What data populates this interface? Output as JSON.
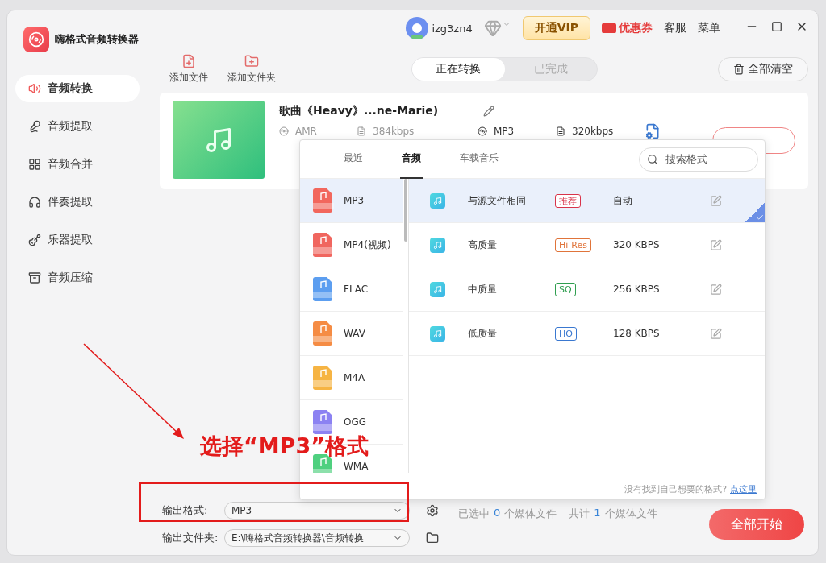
{
  "app": {
    "title": "嗨格式音频转换器"
  },
  "sidebar": {
    "items": [
      {
        "label": "音频转换",
        "selected": true
      },
      {
        "label": "音频提取",
        "selected": false
      },
      {
        "label": "音频合并",
        "selected": false
      },
      {
        "label": "伴奏提取",
        "selected": false
      },
      {
        "label": "乐器提取",
        "selected": false
      },
      {
        "label": "音频压缩",
        "selected": false
      }
    ]
  },
  "header": {
    "username": "izg3zn4",
    "vip_button": "开通VIP",
    "coupon": "优惠券",
    "links": [
      "客服",
      "菜单"
    ]
  },
  "toolbar": {
    "actions": [
      "添加文件",
      "添加文件夹"
    ],
    "tabs": [
      {
        "label": "正在转换",
        "selected": true
      },
      {
        "label": "已完成",
        "selected": false
      }
    ],
    "clear_button": "全部清空"
  },
  "file": {
    "name": "歌曲《Heavy》...ne-Marie)",
    "source_format": "AMR",
    "source_bitrate": "384kbps",
    "target_format": "MP3",
    "target_bitrate": "320kbps"
  },
  "format_picker": {
    "tabs": [
      {
        "label": "最近",
        "selected": false
      },
      {
        "label": "音频",
        "selected": true
      },
      {
        "label": "车载音乐",
        "selected": false
      }
    ],
    "search": {
      "placeholder": "搜索格式"
    },
    "formats": [
      {
        "label": "MP3",
        "color": "#f2675d",
        "selected": true
      },
      {
        "label": "MP4(视频)",
        "color": "#f0665f",
        "selected": false
      },
      {
        "label": "FLAC",
        "color": "#5c9ef0",
        "selected": false
      },
      {
        "label": "WAV",
        "color": "#f58c44",
        "selected": false
      },
      {
        "label": "M4A",
        "color": "#f6b443",
        "selected": false
      },
      {
        "label": "OGG",
        "color": "#8c82f2",
        "selected": false
      },
      {
        "label": "WMA",
        "color": "#4fd07f",
        "selected": false
      }
    ],
    "presets": [
      {
        "name": "与源文件相同",
        "tag": "推荐",
        "color": "#d8334a",
        "bitrate": "自动",
        "selected": true
      },
      {
        "name": "高质量",
        "tag": "Hi-Res",
        "color": "#e0743a",
        "bitrate": "320 KBPS",
        "selected": false
      },
      {
        "name": "中质量",
        "tag": "SQ",
        "color": "#2f9e4f",
        "bitrate": "256 KBPS",
        "selected": false
      },
      {
        "name": "低质量",
        "tag": "HQ",
        "color": "#3a78d0",
        "bitrate": "128 KBPS",
        "selected": false
      }
    ],
    "footer_note": "没有找到自己想要的格式?",
    "footer_link": "点这里"
  },
  "footer": {
    "format_label": "输出格式:",
    "format_value": "MP3",
    "folder_label": "输出文件夹:",
    "folder_value": "E:\\嗨格式音频转换器\\音频转换",
    "selected_prefix": "已选中",
    "selected_count": "0",
    "selected_suffix": "个媒体文件",
    "total_prefix": "共计",
    "total_count": "1",
    "total_suffix": "个媒体文件",
    "start_button": "全部开始"
  },
  "annotation": {
    "text": "选择“MP3”格式"
  }
}
